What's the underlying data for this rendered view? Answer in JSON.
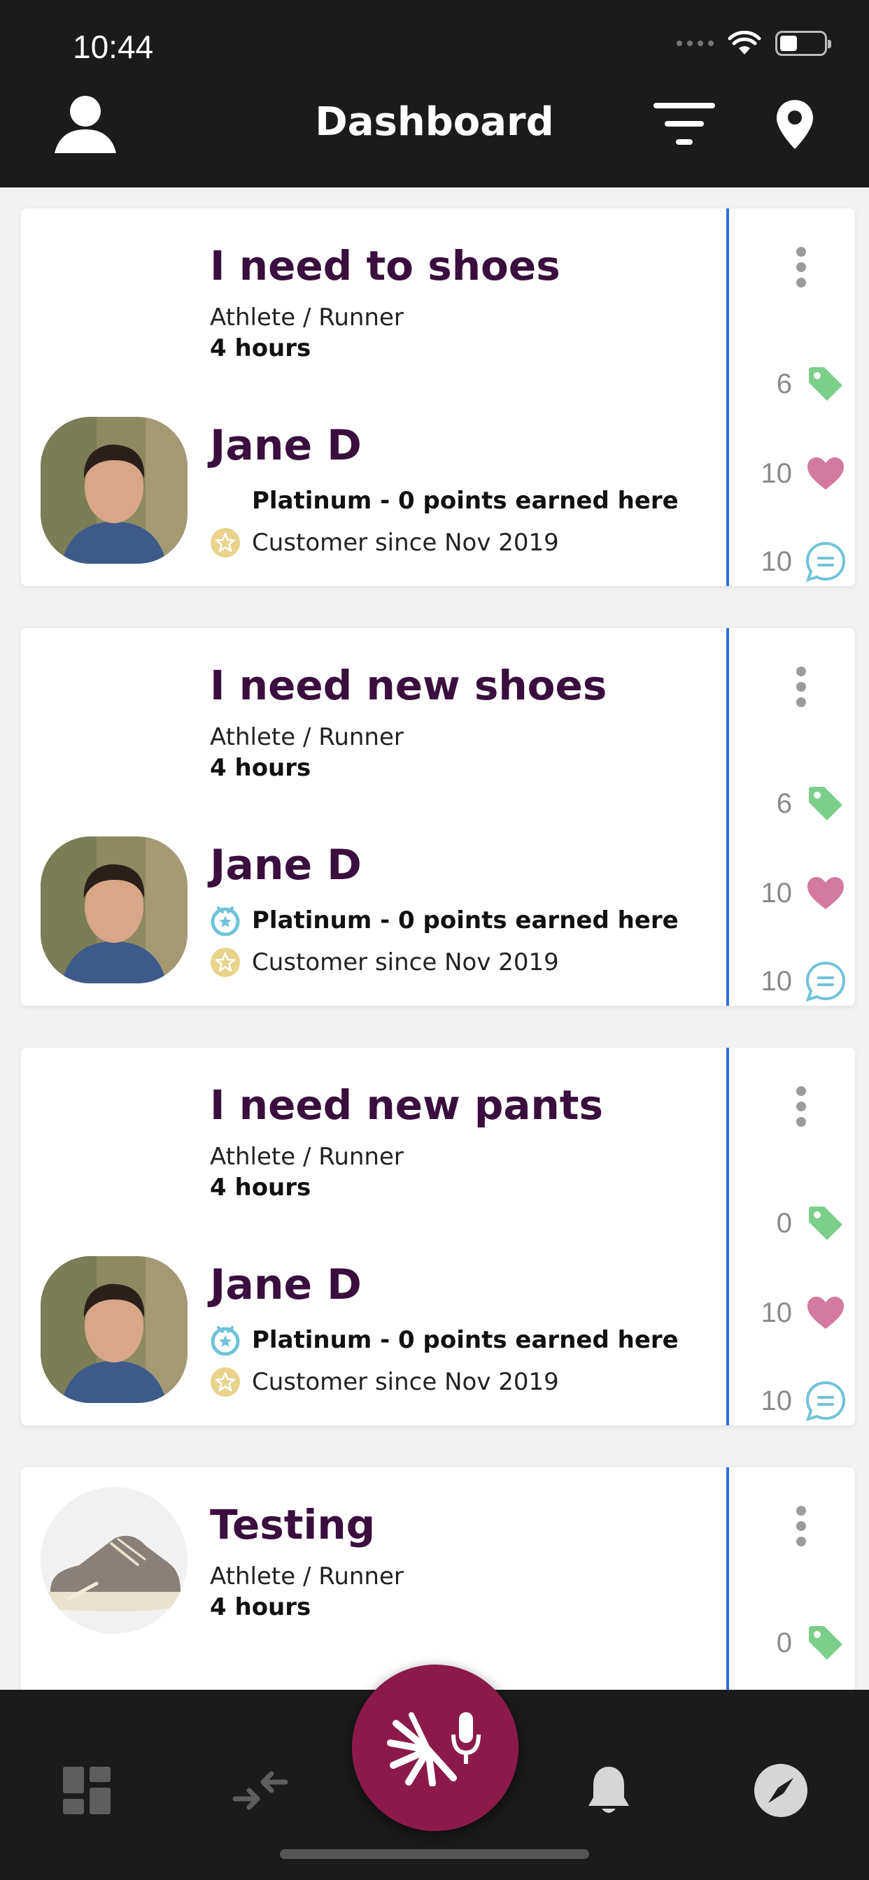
{
  "status_bar": {
    "time": "10:44"
  },
  "header": {
    "title": "Dashboard"
  },
  "cards": [
    {
      "title": "I need to shoes",
      "subtitle": "Athlete / Runner",
      "time_ago": "4 hours",
      "customer_name": "Jane D",
      "tier_text": "Platinum - 0 points earned here",
      "tier_icon_visible": false,
      "since_text": "Customer since Nov 2019",
      "tags_count": "6",
      "likes_count": "10",
      "comments_count": "10"
    },
    {
      "title": "I need new shoes",
      "subtitle": "Athlete / Runner",
      "time_ago": "4 hours",
      "customer_name": "Jane D",
      "tier_text": "Platinum - 0 points earned here",
      "tier_icon_visible": true,
      "since_text": "Customer since Nov 2019",
      "tags_count": "6",
      "likes_count": "10",
      "comments_count": "10"
    },
    {
      "title": "I need new pants",
      "subtitle": "Athlete / Runner",
      "time_ago": "4 hours",
      "customer_name": "Jane D",
      "tier_text": "Platinum - 0 points earned here",
      "tier_icon_visible": true,
      "since_text": "Customer since Nov 2019",
      "tags_count": "0",
      "likes_count": "10",
      "comments_count": "10"
    },
    {
      "title": "Testing",
      "subtitle": "Athlete / Runner",
      "time_ago": "4 hours",
      "tags_count": "0"
    }
  ],
  "colors": {
    "header_bg": "#1b1b1b",
    "title_purple": "#3a0e3e",
    "divider_blue": "#2f6fe0",
    "tag_green": "#7ccf8a",
    "heart_pink": "#d47aa0",
    "comment_teal": "#6fc3d9",
    "fab_magenta": "#8b1a4a",
    "star_gold": "#e9d28a"
  },
  "icons": {
    "profile": "user-icon",
    "filter": "filter-icon",
    "location": "location-pin-icon",
    "more": "more-vertical-icon",
    "tag": "tag-icon",
    "heart": "heart-icon",
    "comment": "comment-icon",
    "tier": "medal-icon",
    "since": "star-badge-icon",
    "nav_dashboard": "dashboard-icon",
    "nav_transfer": "transfer-arrows-icon",
    "nav_fab": "voice-assistant-icon",
    "nav_bell": "bell-icon",
    "nav_compass": "compass-icon"
  }
}
